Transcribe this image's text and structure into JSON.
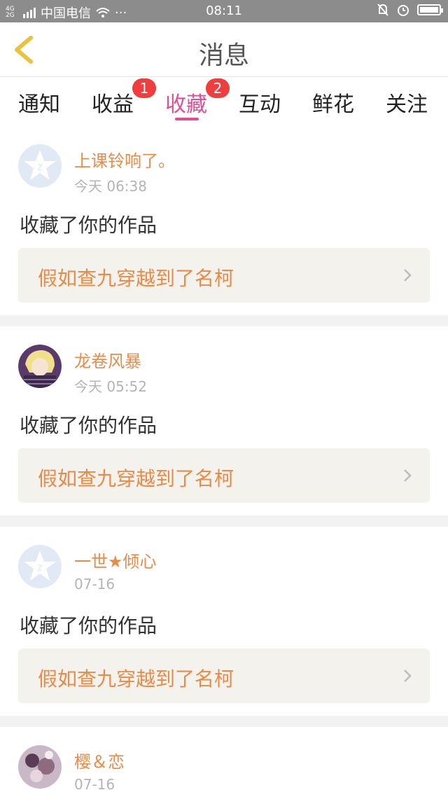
{
  "status_bar": {
    "network": "4G 2G",
    "carrier": "中国电信",
    "more": "···",
    "time": "08:11"
  },
  "header": {
    "title": "消息"
  },
  "tabs": [
    {
      "label": "通知",
      "badge": ""
    },
    {
      "label": "收益",
      "badge": "1"
    },
    {
      "label": "收藏",
      "badge": "2",
      "active": true
    },
    {
      "label": "互动",
      "badge": ""
    },
    {
      "label": "鲜花",
      "badge": ""
    },
    {
      "label": "关注",
      "badge": ""
    }
  ],
  "messages": [
    {
      "user": "上课铃响了。",
      "time": "今天 06:38",
      "action": "收藏了你的作品",
      "work": "假如查九穿越到了名柯",
      "avatar": "default-avatar"
    },
    {
      "user": "龙卷风暴",
      "time": "今天 05:52",
      "action": "收藏了你的作品",
      "work": "假如查九穿越到了名柯",
      "avatar": "anime-avatar"
    },
    {
      "user": "一世★倾心",
      "time": "07-16",
      "action": "收藏了你的作品",
      "work": "假如查九穿越到了名柯",
      "avatar": "default-avatar"
    },
    {
      "user": "樱＆恋",
      "time": "07-16",
      "action": "",
      "work": "",
      "avatar": "photo-avatar"
    }
  ],
  "colors": {
    "accent": "#e44d95",
    "name": "#e88b48",
    "badge": "#f03d3d"
  }
}
